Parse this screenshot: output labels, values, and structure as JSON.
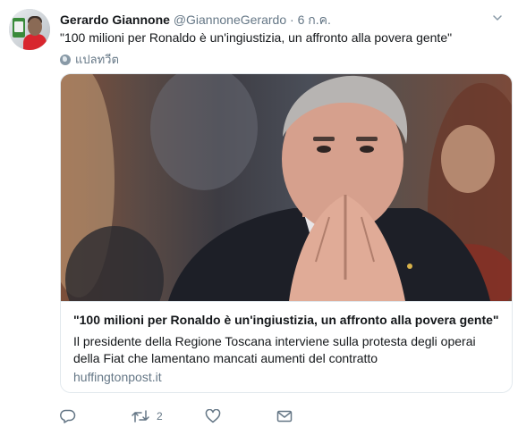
{
  "tweet": {
    "author_name": "Gerardo Giannone",
    "author_handle": "@GiannoneGerardo",
    "separator": "·",
    "timestamp": "6 ก.ค.",
    "text": "\"100 milioni per Ronaldo è un'ingiustizia, un affronto alla povera gente\"",
    "translate_label": "แปลทวีต"
  },
  "card": {
    "title": "\"100 milioni per Ronaldo è un'ingiustizia, un affronto alla povera gente\"",
    "description": "Il presidente della Regione Toscana interviene sulla protesta degli operai della Fiat che lamentano mancati aumenti del contratto",
    "domain": "huffingtonpost.it"
  },
  "actions": {
    "reply_icon": "reply-icon",
    "retweet_icon": "retweet-icon",
    "retweet_count": "2",
    "like_icon": "heart-icon",
    "dm_icon": "envelope-icon"
  },
  "colors": {
    "text_primary": "#14171a",
    "text_secondary": "#657786",
    "border": "#e1e8ed"
  }
}
